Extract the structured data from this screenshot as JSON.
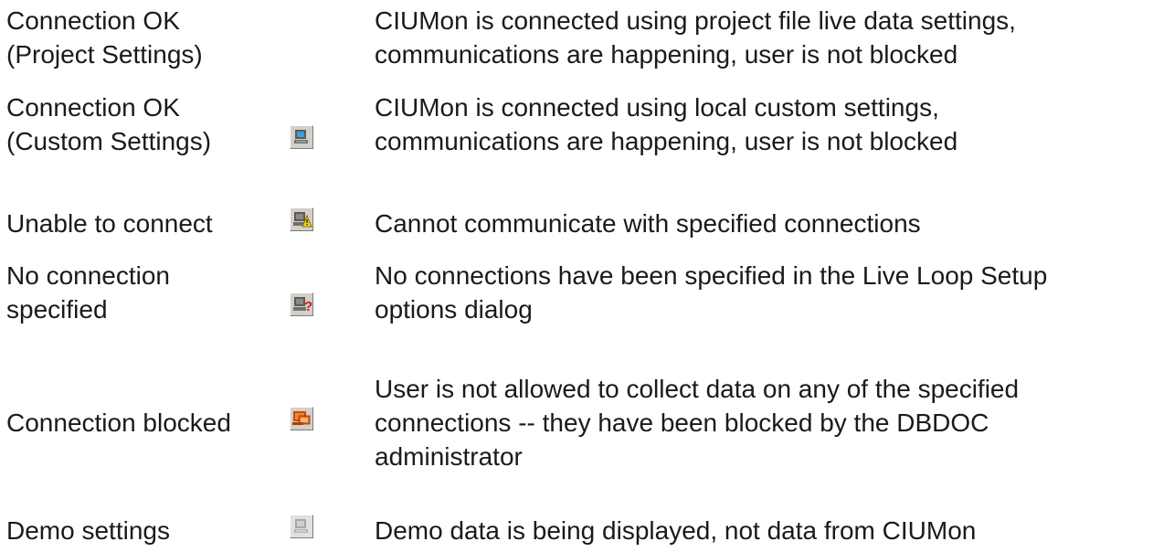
{
  "rows": [
    {
      "state": [
        "Connection OK",
        "(Project Settings)"
      ],
      "icon": "none",
      "description": [
        "CIUMon is connected using project file live data settings,",
        "communications are happening, user is not blocked"
      ]
    },
    {
      "state": [
        "Connection OK",
        "(Custom Settings)"
      ],
      "icon": "computer-blue-icon",
      "description": [
        "CIUMon is connected using local custom settings,",
        "communications are happening, user is not blocked"
      ]
    },
    {
      "state": [
        "Unable to connect"
      ],
      "icon": "computer-warning-icon",
      "description": [
        "Cannot communicate with specified connections"
      ]
    },
    {
      "state": [
        "No connection",
        "specified"
      ],
      "icon": "computer-question-icon",
      "description": [
        "No connections have been specified in the Live Loop Setup",
        "options dialog"
      ]
    },
    {
      "state": [
        "Connection blocked"
      ],
      "icon": "computer-blocked-icon",
      "description": [
        "User is not allowed to collect data on any of the specified",
        "connections -- they have been blocked by the DBDOC",
        "administrator"
      ]
    },
    {
      "state": [
        "Demo settings"
      ],
      "icon": "computer-demo-icon",
      "description": [
        "Demo data is being displayed, not data from CIUMon"
      ]
    }
  ],
  "colors": {
    "text": "#1a1a1a",
    "icon_face": "#d4d0c8",
    "blue_accent": "#3aa0d8",
    "warning_yellow": "#f2d400",
    "question_red": "#d01818",
    "blocked_orange": "#e8641a"
  }
}
